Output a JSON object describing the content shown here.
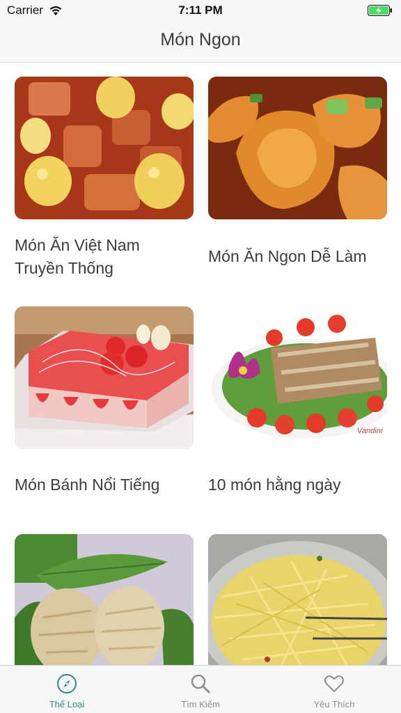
{
  "status_bar": {
    "carrier": "Carrier",
    "time": "7:11 PM",
    "battery_level": 1.0,
    "battery_color": "#4cd964"
  },
  "nav": {
    "title": "Món Ngon"
  },
  "categories": [
    {
      "title_line1": "Món Ăn Việt Nam",
      "title_line2": "Truyền Thống",
      "image": "braised-pork-eggs"
    },
    {
      "title_line1": "Món Ăn Ngon Dễ Làm",
      "title_line2": "",
      "image": "shrimp-dish"
    },
    {
      "title_line1": "Món Bánh Nổi Tiếng",
      "title_line2": "",
      "image": "strawberry-cake"
    },
    {
      "title_line1": "10 món hằng ngày",
      "title_line2": "",
      "image": "fried-fish-plate",
      "image_watermark": "Vandini"
    },
    {
      "title_line1": "",
      "title_line2": "",
      "image": "fried-rolls-greens"
    },
    {
      "title_line1": "",
      "title_line2": "",
      "image": "papaya-salad"
    }
  ],
  "tab_bar": {
    "active_color": "#2a8a8c",
    "inactive_color": "#8e8e93",
    "tabs": [
      {
        "label": "Thể Loại",
        "icon": "compass-icon",
        "active": true
      },
      {
        "label": "Tìm Kiếm",
        "icon": "search-icon",
        "active": false
      },
      {
        "label": "Yêu Thích",
        "icon": "heart-icon",
        "active": false
      }
    ]
  }
}
